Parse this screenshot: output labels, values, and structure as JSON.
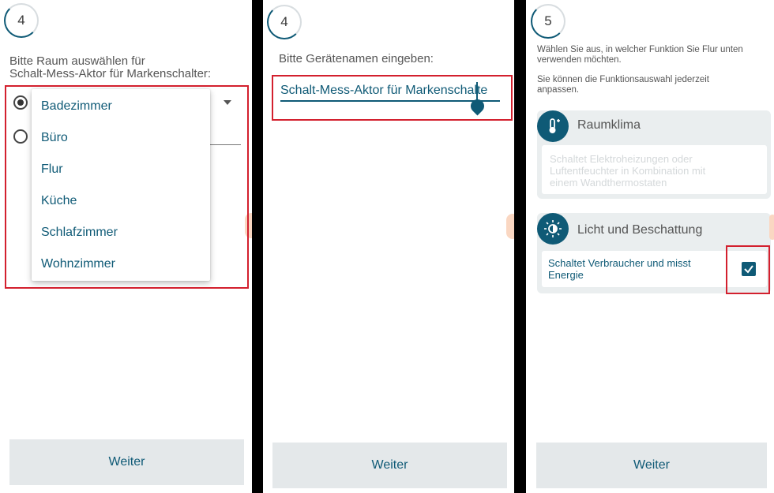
{
  "panel1": {
    "step": "4",
    "instruction_line1": "Bitte Raum auswählen für",
    "instruction_line2": "Schalt-Mess-Aktor für Markenschalter:",
    "rooms": [
      "Badezimmer",
      "Büro",
      "Flur",
      "Küche",
      "Schlafzimmer",
      "Wohnzimmer"
    ],
    "selected_room": "Badezimmer",
    "next_button": "Weiter"
  },
  "panel2": {
    "step": "4",
    "instruction": "Bitte Gerätenamen eingeben:",
    "device_name_value": "Schalt-Mess-Aktor für Markenschalte",
    "next_button": "Weiter"
  },
  "panel3": {
    "step": "5",
    "intro_line1": "Wählen Sie aus, in welcher Funktion Sie Flur unten",
    "intro_line2": "verwenden möchten.",
    "hint_line1": "Sie können die Funktionsauswahl jederzeit",
    "hint_line2": "anpassen.",
    "option1": {
      "title": "Raumklima",
      "desc_line1": "Schaltet Elektroheizungen oder",
      "desc_line2": "Luftentfeuchter in Kombination mit",
      "desc_line3": "einem Wandthermostaten",
      "icon": "thermometer-icon"
    },
    "option2": {
      "title": "Licht und Beschattung",
      "desc_line1": "Schaltet Verbraucher und misst",
      "desc_line2": "Energie",
      "icon": "sun-icon",
      "checked": true
    },
    "next_button": "Weiter"
  },
  "colors": {
    "accent": "#0f5a76",
    "highlight": "#d3202e",
    "button_bg": "#e4e8ea",
    "card_bg": "#eaeeef"
  }
}
